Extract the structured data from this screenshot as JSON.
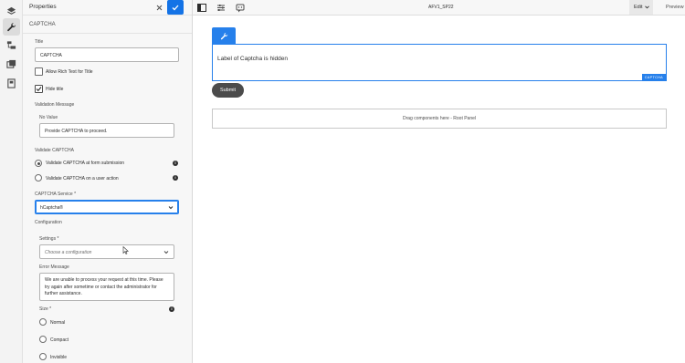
{
  "panel": {
    "title": "Properties",
    "component_name": "CAPTCHA",
    "title_label": "Title",
    "title_value": "CAPTCHA",
    "allow_rich_text_label": "Allow Rich Text for Title",
    "hide_title_label": "Hide title",
    "validation_message_label": "Validation Message",
    "no_value_label": "No Value",
    "no_value_value": "Provide CAPTCHA to proceed.",
    "validate_captcha_label": "Validate CAPTCHA",
    "validate_options": [
      {
        "label": "Validate CAPTCHA at form submission",
        "selected": true
      },
      {
        "label": "Validate CAPTCHA on a user action",
        "selected": false
      }
    ],
    "captcha_service_label": "CAPTCHA Service *",
    "captcha_service_value": "hCaptcha®",
    "configuration_label": "Configuration",
    "settings_label": "Settings *",
    "settings_placeholder": "Choose a configuration",
    "error_message_label": "Error Message",
    "error_message_value": "We are unable to process your request at this time. Please try again after sometime or contact the administrator for further assistance.",
    "size_label": "Size *",
    "size_options": [
      {
        "label": "Normal",
        "selected": false
      },
      {
        "label": "Compact",
        "selected": false
      },
      {
        "label": "Invisible",
        "selected": false
      }
    ]
  },
  "topbar": {
    "page_name": "AFV1_SP22",
    "edit_label": "Edit",
    "preview_label": "Preview"
  },
  "canvas": {
    "captcha_text": "Label of Captcha is hidden",
    "captcha_badge": "CAPTCHA",
    "submit_label": "Submit",
    "drop_zone_text": "Drag components here - Root Panel"
  },
  "colors": {
    "accent": "#2680eb",
    "confirm": "#1473e6",
    "submit_bg": "#4b4b4b"
  },
  "icons": [
    "layers-icon",
    "wrench-icon",
    "content-tree-icon",
    "assets-icon",
    "site-icon",
    "close-icon",
    "checkmark-icon",
    "toggle-side-panel-icon",
    "properties-icon",
    "annotations-icon",
    "chevron-down-icon",
    "info-icon"
  ]
}
